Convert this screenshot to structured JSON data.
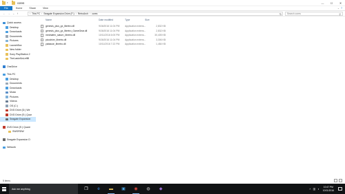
{
  "window": {
    "title": "cores",
    "controls": {
      "minimize": "—",
      "maximize": "☐",
      "close": "✕"
    }
  },
  "ribbon": {
    "tabs": [
      "File",
      "Home",
      "Share",
      "View"
    ],
    "help_icon": "?"
  },
  "address": {
    "path": [
      "This PC",
      "Seagate Expansion Drive (F:)",
      "RetroArch",
      "cores"
    ],
    "search_placeholder": "Search cores"
  },
  "navpane": {
    "items": [
      {
        "label": "Quick access",
        "indent": 0,
        "icon": "star-icon",
        "color": "#3d8fd6"
      },
      {
        "label": "Desktop",
        "indent": 1,
        "icon": "desktop-icon",
        "color": "#4a9ee0"
      },
      {
        "label": "Downloads",
        "indent": 1,
        "icon": "download-icon",
        "color": "#4a9ee0"
      },
      {
        "label": "Documents",
        "indent": 1,
        "icon": "documents-icon",
        "color": "#9aa7b4"
      },
      {
        "label": "Pictures",
        "indent": 1,
        "icon": "pictures-icon",
        "color": "#7fb1d9"
      },
      {
        "label": "LaunchBox",
        "indent": 1,
        "icon": "folder-icon",
        "color": "#e8c15a"
      },
      {
        "label": "New folder",
        "indent": 1,
        "icon": "folder-icon",
        "color": "#e8c15a"
      },
      {
        "label": "Sony PlayStation 2",
        "indent": 1,
        "icon": "folder-icon",
        "color": "#e8c15a"
      },
      {
        "label": "TheLastofUsLeftB",
        "indent": 1,
        "icon": "folder-icon",
        "color": "#e8c15a"
      },
      {
        "gap": true
      },
      {
        "label": "OneDrive",
        "indent": 0,
        "icon": "cloud-icon",
        "color": "#2f7fd1"
      },
      {
        "gap": true
      },
      {
        "label": "This PC",
        "indent": 0,
        "icon": "computer-icon",
        "color": "#4a9ee0"
      },
      {
        "label": "Desktop",
        "indent": 1,
        "icon": "desktop-icon",
        "color": "#4a9ee0"
      },
      {
        "label": "Documents",
        "indent": 1,
        "icon": "documents-icon",
        "color": "#9aa7b4"
      },
      {
        "label": "Downloads",
        "indent": 1,
        "icon": "download-icon",
        "color": "#4a9ee0"
      },
      {
        "label": "Music",
        "indent": 1,
        "icon": "music-icon",
        "color": "#5c8fc7"
      },
      {
        "label": "Pictures",
        "indent": 1,
        "icon": "pictures-icon",
        "color": "#7fb1d9"
      },
      {
        "label": "Videos",
        "indent": 1,
        "icon": "videos-icon",
        "color": "#6a7d93"
      },
      {
        "label": "OS (C:)",
        "indent": 1,
        "icon": "drive-icon",
        "color": "#8fa2b6"
      },
      {
        "label": "DVD Drive (D:) Wir",
        "indent": 1,
        "icon": "dvd-icon",
        "color": "#c0392b"
      },
      {
        "label": "DVD Drive (E:) Quar",
        "indent": 1,
        "icon": "dvd-icon",
        "color": "#c0392b"
      },
      {
        "label": "Seagate Expansion",
        "indent": 1,
        "icon": "drive-icon",
        "color": "#6b6b6b",
        "selected": true
      },
      {
        "gap": true
      },
      {
        "label": "DVD Drive (E:) Quant",
        "indent": 0,
        "icon": "dvd-icon",
        "color": "#c0392b"
      },
      {
        "label": "SWORDW",
        "indent": 2,
        "icon": "folder-icon",
        "color": "#e8c15a"
      },
      {
        "gap": true
      },
      {
        "label": "Seagate Expansion D",
        "indent": 0,
        "icon": "drive-icon",
        "color": "#6b6b6b"
      },
      {
        "gap": true
      },
      {
        "label": "Network",
        "indent": 0,
        "icon": "network-icon",
        "color": "#4a9ee0"
      }
    ]
  },
  "files": {
    "columns": [
      "Name",
      "Date modified",
      "Type",
      "Size"
    ],
    "rows": [
      {
        "name": "genesis_plus_gx_libretro.dll",
        "date": "9/26/2016 11:04 PM",
        "type": "Application extens...",
        "size": "2,832 KB"
      },
      {
        "name": "genesis_plus_gx_libretro_GameGear.dll",
        "date": "9/26/2016 11:04 PM",
        "type": "Application extens...",
        "size": "2,832 KB"
      },
      {
        "name": "mednafen_saturn_libretro.dll",
        "date": "10/11/2016 6:00 PM",
        "type": "Application extens...",
        "size": "30,405 KB"
      },
      {
        "name": "picodrive_libretro.dll",
        "date": "9/26/2016 11:04 PM",
        "type": "Application extens...",
        "size": "3,306 KB"
      },
      {
        "name": "yabause_libretro.dll",
        "date": "10/11/2016 7:22 PM",
        "type": "Application extens...",
        "size": "1,484 KB"
      }
    ]
  },
  "status": {
    "item_count": "5 items"
  },
  "taskbar": {
    "search_text": "Ask me anything",
    "time": "10:47 PM",
    "date": "10/11/2016"
  }
}
